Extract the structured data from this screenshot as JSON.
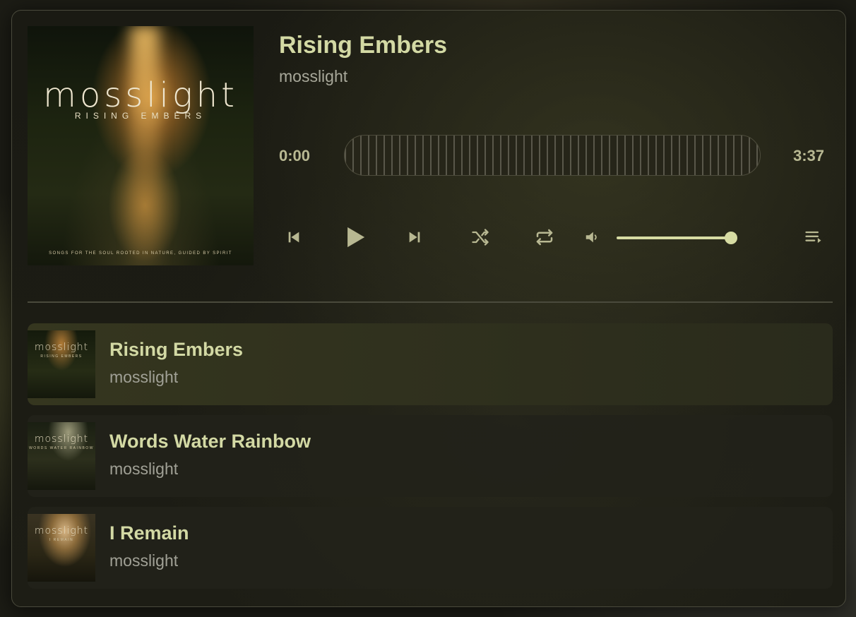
{
  "now_playing": {
    "title": "Rising Embers",
    "artist": "mosslight",
    "cover": {
      "band": "mosslight",
      "album": "RISING EMBERS",
      "tagline": "SONGS FOR THE SOUL ROOTED IN NATURE, GUIDED BY SPIRIT"
    }
  },
  "progress": {
    "current": "0:00",
    "total": "3:37",
    "fraction": 0
  },
  "controls": {
    "previous_icon": "skip-previous-icon",
    "play_icon": "play-icon",
    "next_icon": "skip-next-icon",
    "shuffle_icon": "shuffle-icon",
    "repeat_icon": "repeat-icon",
    "volume_icon": "volume-icon",
    "queue_icon": "queue-icon",
    "volume_level": 0.95
  },
  "colors": {
    "accent": "#d3d9a4",
    "muted_text": "#a8a89a",
    "panel_border": "#4a4a3c"
  },
  "playlist": [
    {
      "title": "Rising Embers",
      "artist": "mosslight",
      "cover_band": "mosslight",
      "cover_album": "RISING EMBERS",
      "active": true
    },
    {
      "title": "Words Water Rainbow",
      "artist": "mosslight",
      "cover_band": "mosslight",
      "cover_album": "WORDS WATER RAINBOW",
      "active": false
    },
    {
      "title": "I Remain",
      "artist": "mosslight",
      "cover_band": "mosslight",
      "cover_album": "I REMAIN",
      "active": false
    }
  ]
}
